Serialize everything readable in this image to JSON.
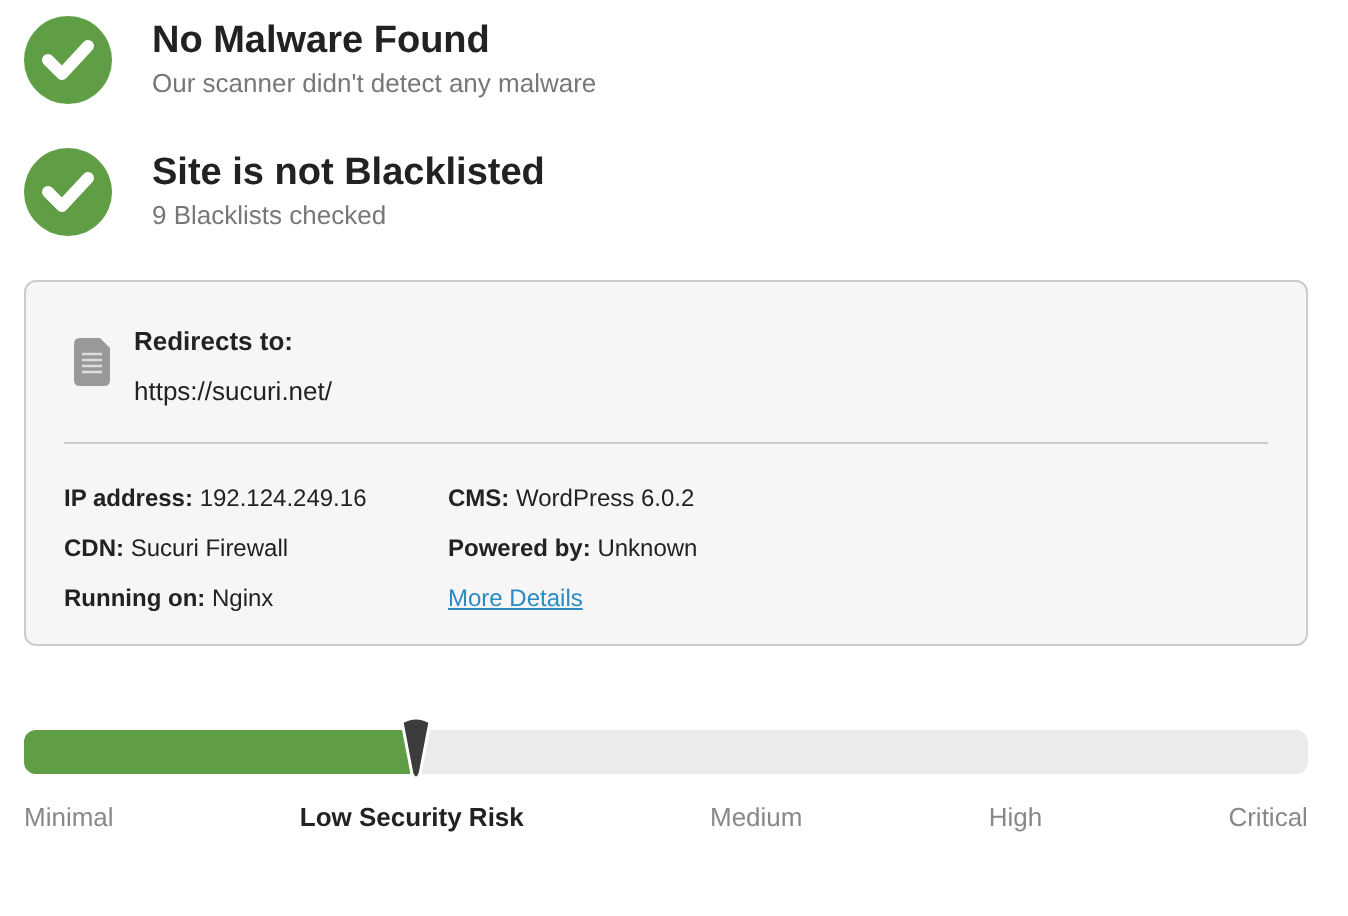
{
  "checks": [
    {
      "title": "No Malware Found",
      "subtitle": "Our scanner didn't detect any malware"
    },
    {
      "title": "Site is not Blacklisted",
      "subtitle": "9 Blacklists checked"
    }
  ],
  "redirect": {
    "label": "Redirects to:",
    "url": "https://sucuri.net/"
  },
  "details": [
    [
      {
        "kind": "field",
        "label": "IP address:",
        "value": "192.124.249.16"
      },
      {
        "kind": "field",
        "label": "CDN:",
        "value": "Sucuri Firewall"
      },
      {
        "kind": "field",
        "label": "Running on:",
        "value": "Nginx"
      }
    ],
    [
      {
        "kind": "field",
        "label": "CMS:",
        "value": "WordPress 6.0.2"
      },
      {
        "kind": "field",
        "label": "Powered by:",
        "value": "Unknown"
      },
      {
        "kind": "link",
        "label": "More Details"
      }
    ]
  ],
  "risk": {
    "level": 0.3,
    "labels": [
      {
        "label": "Minimal",
        "selected": false
      },
      {
        "label": "Low Security Risk",
        "selected": true
      },
      {
        "label": "Medium",
        "selected": false
      },
      {
        "label": "High",
        "selected": false
      },
      {
        "label": "Critical",
        "selected": false
      }
    ]
  }
}
